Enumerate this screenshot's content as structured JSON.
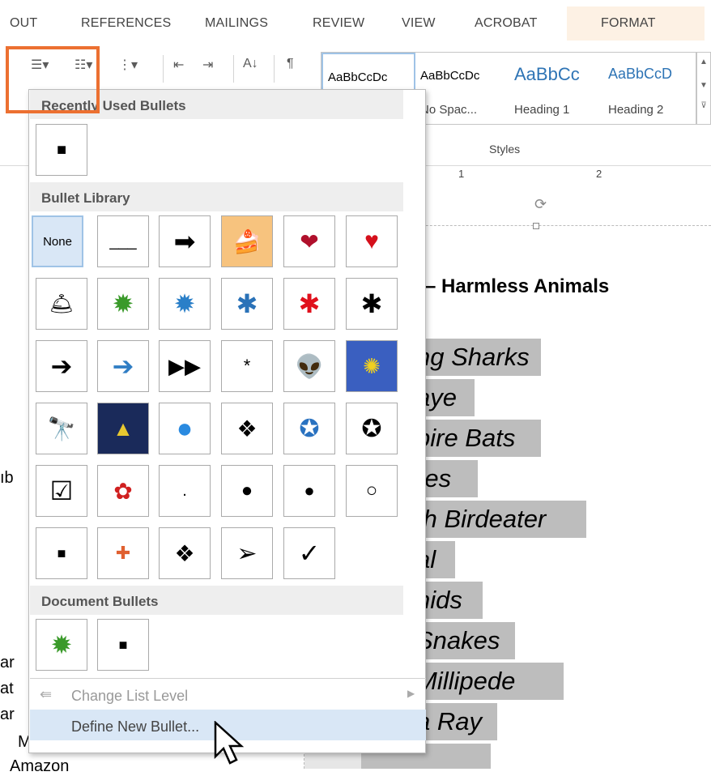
{
  "ribbon_tabs": [
    "OUT",
    "REFERENCES",
    "MAILINGS",
    "REVIEW",
    "VIEW",
    "ACROBAT",
    "FORMAT"
  ],
  "styles": {
    "items": [
      {
        "preview": "AaBbCcDc",
        "name": ""
      },
      {
        "preview": "AaBbCcDc",
        "name": "No Spac..."
      },
      {
        "preview": "AaBbCc",
        "name": "Heading 1"
      },
      {
        "preview": "AaBbCcD",
        "name": "Heading 2"
      }
    ],
    "group_label": "Styles"
  },
  "ruler": {
    "marks": [
      "1",
      "2"
    ]
  },
  "document": {
    "title": "– Harmless Animals",
    "items": [
      "ng Sharks",
      "aye",
      "pire Bats",
      "res",
      "th Birdeater",
      "al",
      "nids",
      "Snakes",
      "Millipede",
      "a Ray"
    ],
    "left_fragments": [
      "ıb",
      "ar",
      "at",
      "ar",
      "M",
      "Amazon"
    ]
  },
  "bullets_menu": {
    "recent_header": "Recently Used Bullets",
    "library_header": "Bullet Library",
    "document_header": "Document Bullets",
    "none_label": "None",
    "change_level": "Change List Level",
    "define_new": "Define New Bullet..."
  },
  "colors": {
    "accent_orange": "#ec7031",
    "format_tab_bg": "#fdf1e4",
    "highlight": "#bdbdbd",
    "hover_blue": "#d9e7f6"
  }
}
